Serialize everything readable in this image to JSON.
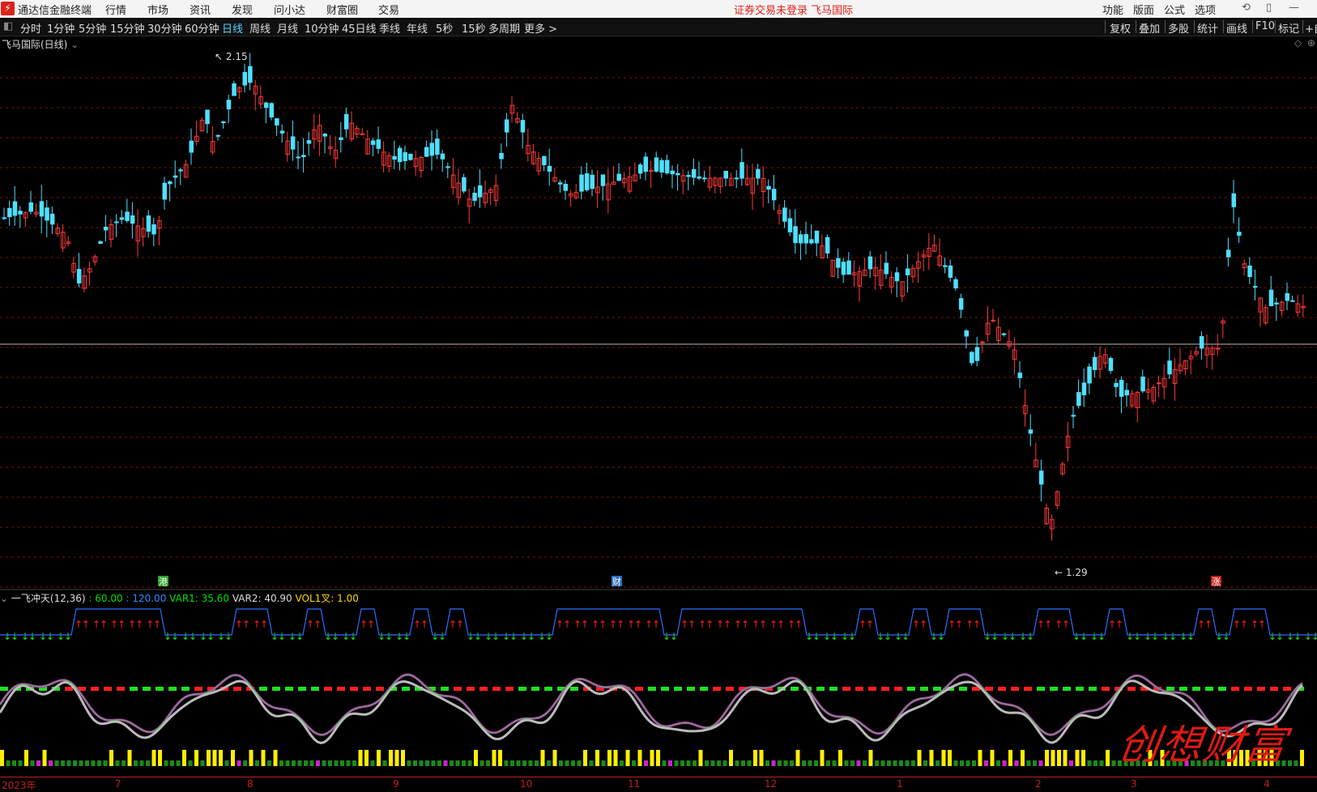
{
  "app": {
    "name": "通达信金融终端",
    "notice": "证券交易未登录  飞马国际",
    "logo_glyph": "⚡"
  },
  "menu": [
    "行情",
    "市场",
    "资讯",
    "发现",
    "问小达",
    "财富圈",
    "交易"
  ],
  "right_menu": [
    "功能",
    "版面",
    "公式",
    "选项"
  ],
  "timeframes": [
    "分时",
    "1分钟",
    "5分钟",
    "15分钟",
    "30分钟",
    "60分钟",
    "日线",
    "周线",
    "月线",
    "10分钟",
    "45日线",
    "季线",
    "年线",
    "5秒",
    "15秒",
    "多周期",
    "更多 >"
  ],
  "active_timeframe": "日线",
  "toolbar_right": [
    "复权",
    "叠加",
    "多股",
    "统计",
    "画线",
    "F10",
    "标记",
    "+自"
  ],
  "chart_title": "飞马国际(日线)",
  "price_labels": {
    "high": "2.15",
    "low": "1.29"
  },
  "event_markers": [
    "港",
    "财",
    "涨"
  ],
  "indicator": {
    "name": "一飞冲天(12,36)",
    "vals": [
      ": 60.00",
      ": 120.00"
    ],
    "var1": "VAR1: 35.60",
    "var2": "VAR2: 40.90",
    "vol": "VOL1叉: 1.00"
  },
  "date_axis": [
    "2023年",
    "7",
    "8",
    "9",
    "10",
    "11",
    "12",
    "1",
    "2",
    "3",
    "4"
  ],
  "watermark": "创想财富",
  "colors": {
    "up": "#ff3a3a",
    "down": "#4fe0ff",
    "accent": "#4fd6ff",
    "alert": "#e0201a"
  }
}
